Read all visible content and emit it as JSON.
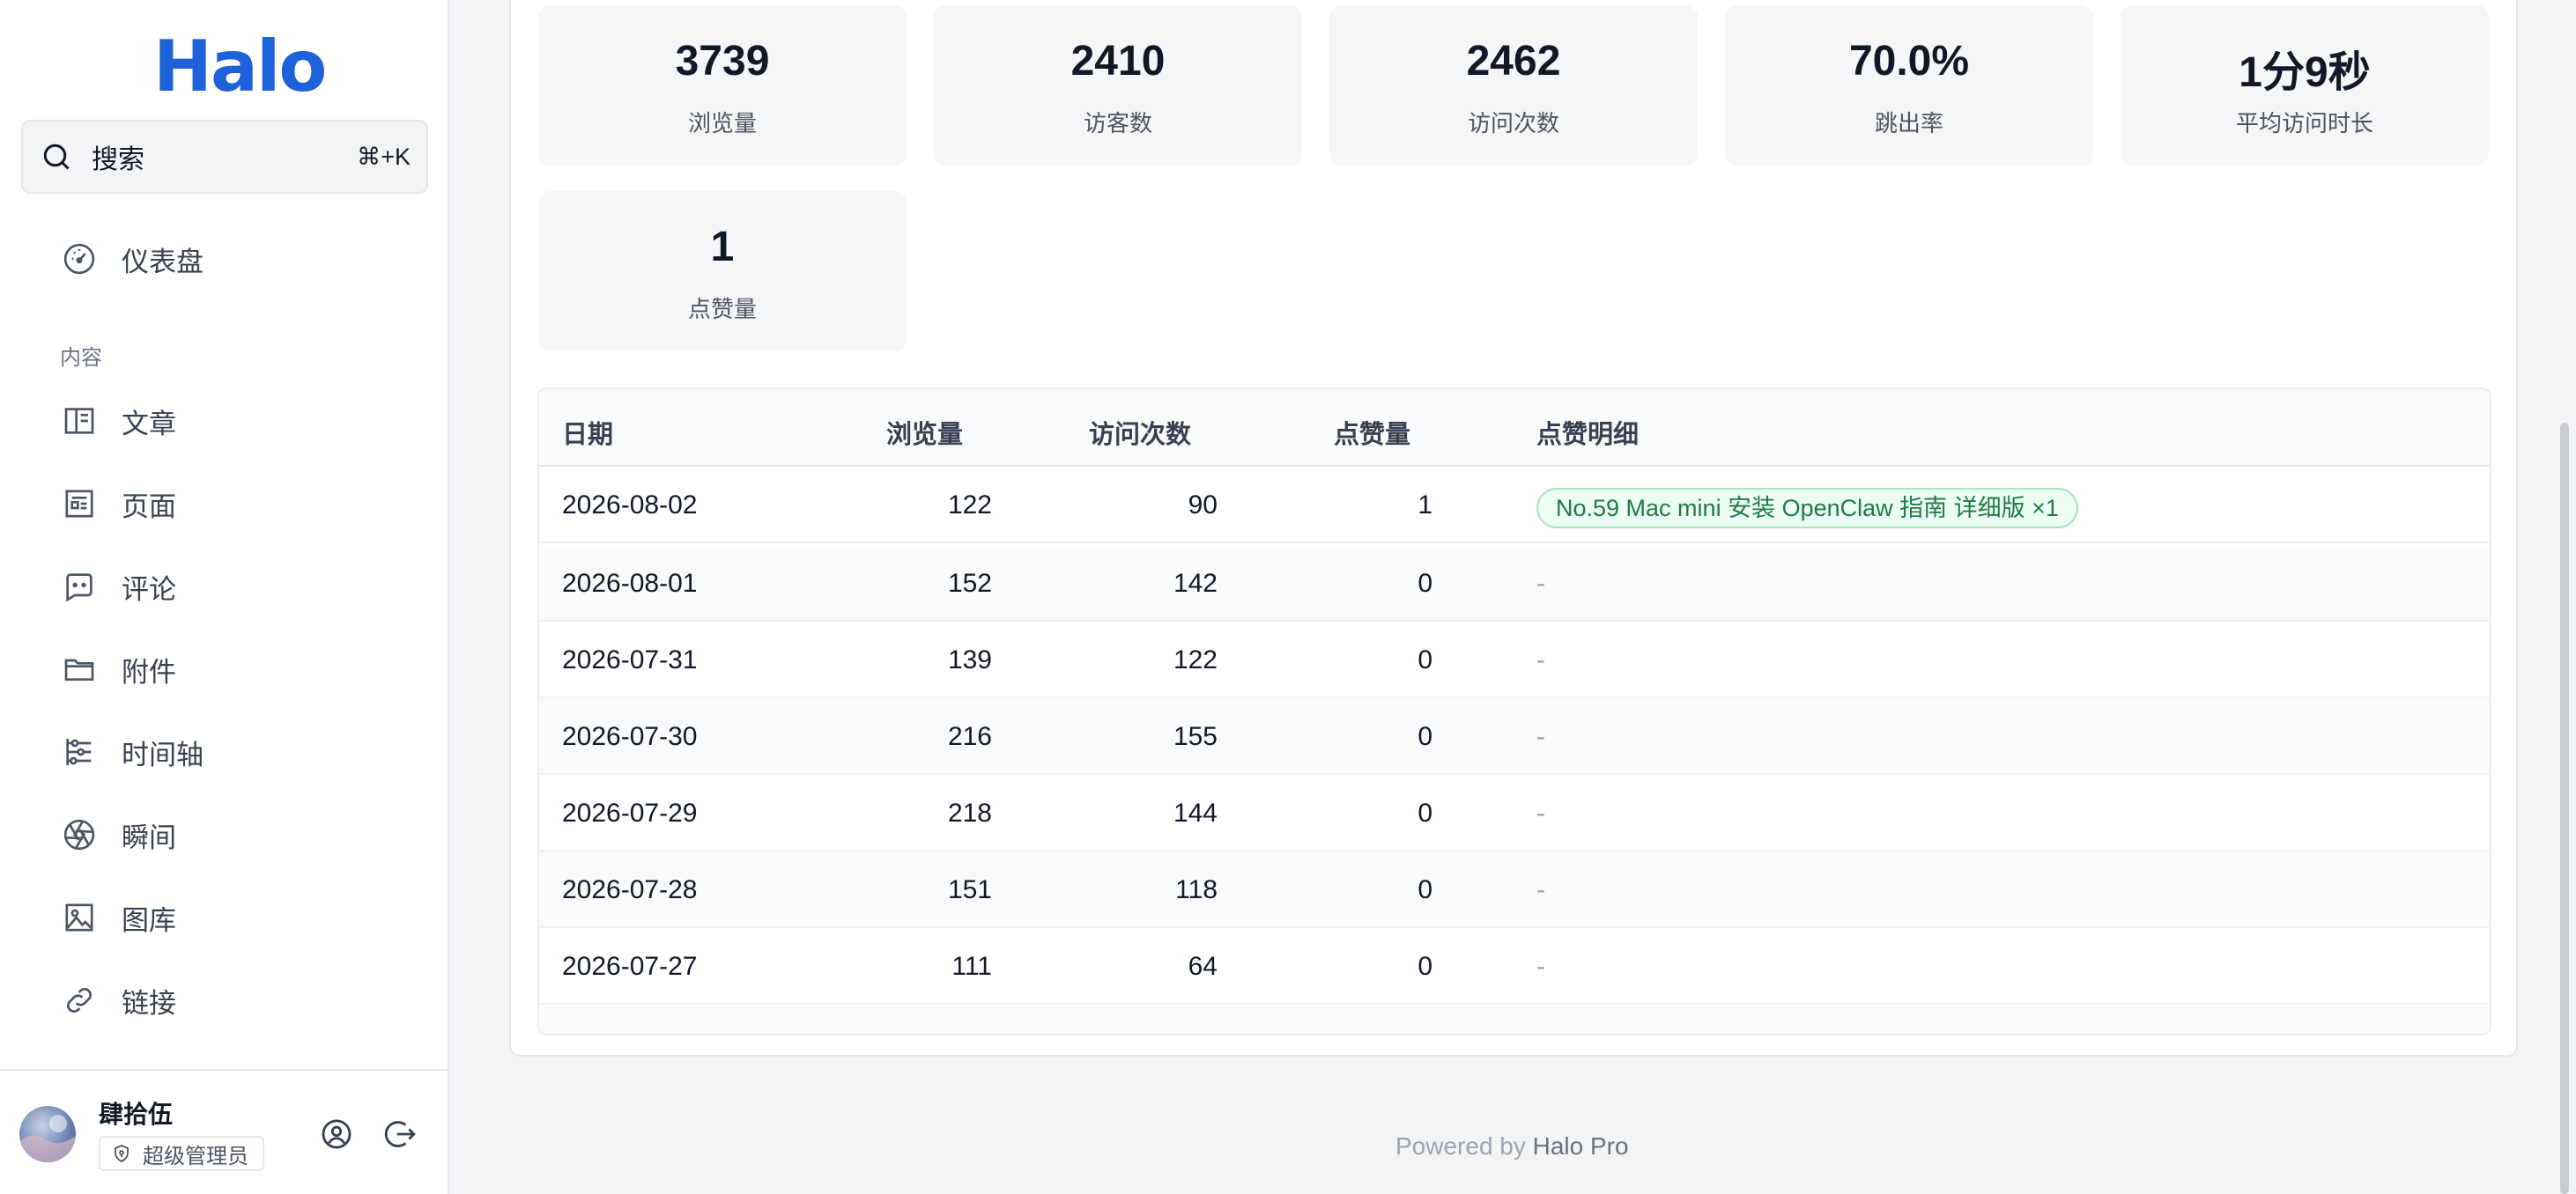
{
  "sidebar": {
    "logo": "Halo",
    "search": {
      "label": "搜索",
      "shortcut": "⌘+K"
    },
    "dashboard": "仪表盘",
    "section_content": "内容",
    "items": [
      {
        "label": "文章",
        "icon": "book-open-icon"
      },
      {
        "label": "页面",
        "icon": "page-icon"
      },
      {
        "label": "评论",
        "icon": "comment-icon"
      },
      {
        "label": "附件",
        "icon": "folder-icon"
      },
      {
        "label": "时间轴",
        "icon": "timeline-icon"
      },
      {
        "label": "瞬间",
        "icon": "aperture-icon"
      },
      {
        "label": "图库",
        "icon": "image-icon"
      },
      {
        "label": "链接",
        "icon": "link-icon"
      }
    ],
    "user": {
      "name": "肆拾伍",
      "role": "超级管理员"
    }
  },
  "stats": [
    {
      "value": "3739",
      "label": "浏览量"
    },
    {
      "value": "2410",
      "label": "访客数"
    },
    {
      "value": "2462",
      "label": "访问次数"
    },
    {
      "value": "70.0%",
      "label": "跳出率"
    },
    {
      "value": "1分9秒",
      "label": "平均访问时长"
    },
    {
      "value": "1",
      "label": "点赞量"
    }
  ],
  "table": {
    "headers": [
      "日期",
      "浏览量",
      "访问次数",
      "点赞量",
      "点赞明细"
    ],
    "rows": [
      {
        "date": "2026-08-02",
        "views": "122",
        "visits": "90",
        "likes": "1",
        "detail": "No.59 Mac mini 安装 OpenClaw 指南 详细版 ×1"
      },
      {
        "date": "2026-08-01",
        "views": "152",
        "visits": "142",
        "likes": "0",
        "detail": "-"
      },
      {
        "date": "2026-07-31",
        "views": "139",
        "visits": "122",
        "likes": "0",
        "detail": "-"
      },
      {
        "date": "2026-07-30",
        "views": "216",
        "visits": "155",
        "likes": "0",
        "detail": "-"
      },
      {
        "date": "2026-07-29",
        "views": "218",
        "visits": "144",
        "likes": "0",
        "detail": "-"
      },
      {
        "date": "2026-07-28",
        "views": "151",
        "visits": "118",
        "likes": "0",
        "detail": "-"
      },
      {
        "date": "2026-07-27",
        "views": "111",
        "visits": "64",
        "likes": "0",
        "detail": "-"
      }
    ]
  },
  "footer": {
    "prefix": "Powered by ",
    "brand": "Halo Pro"
  },
  "colors": {
    "brand": "#1d62d8",
    "tag_bg": "#ecfdf3",
    "tag_text": "#1f7a45"
  }
}
